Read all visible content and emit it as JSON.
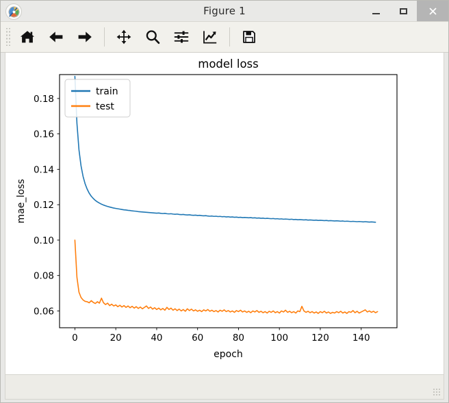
{
  "window": {
    "title": "Figure 1",
    "icon": "matplotlib-logo-icon",
    "minimize_label": "–",
    "maximize_label": "□",
    "close_label": "×"
  },
  "toolbar": {
    "buttons": [
      {
        "name": "home-button",
        "icon": "home-icon",
        "tooltip": "Reset original view"
      },
      {
        "name": "back-button",
        "icon": "arrow-left-icon",
        "tooltip": "Back to previous view"
      },
      {
        "name": "forward-button",
        "icon": "arrow-right-icon",
        "tooltip": "Forward to next view"
      },
      {
        "name": "pan-button",
        "icon": "move-arrows-icon",
        "tooltip": "Pan axes with left mouse, zoom with right"
      },
      {
        "name": "zoom-button",
        "icon": "magnifier-icon",
        "tooltip": "Zoom to rectangle"
      },
      {
        "name": "subplots-button",
        "icon": "sliders-icon",
        "tooltip": "Configure subplots"
      },
      {
        "name": "axis-editor-button",
        "icon": "line-chart-icon",
        "tooltip": "Edit axis, curve and image parameters"
      },
      {
        "name": "save-button",
        "icon": "floppy-disk-icon",
        "tooltip": "Save the figure"
      }
    ]
  },
  "status": {
    "coordinates": ""
  },
  "chart_data": {
    "type": "line",
    "title": "model loss",
    "xlabel": "epoch",
    "ylabel": "mae_loss",
    "grid": false,
    "legend_position": "upper left",
    "xlim": [
      -7.5,
      157.5
    ],
    "ylim": [
      0.0505,
      0.1935
    ],
    "xticks": [
      0,
      20,
      40,
      60,
      80,
      100,
      120,
      140
    ],
    "xtick_labels": [
      "0",
      "20",
      "40",
      "60",
      "80",
      "100",
      "120",
      "140"
    ],
    "yticks": [
      0.06,
      0.08,
      0.1,
      0.12,
      0.14,
      0.16,
      0.18
    ],
    "ytick_labels": [
      "0.06",
      "0.08",
      "0.10",
      "0.12",
      "0.14",
      "0.16",
      "0.18"
    ],
    "colors": {
      "train": "#1f77b4",
      "test": "#ff7f0e"
    },
    "series": [
      {
        "name": "train",
        "color": "#1f77b4",
        "x": [
          0,
          1,
          2,
          3,
          4,
          5,
          6,
          7,
          8,
          9,
          10,
          11,
          12,
          13,
          14,
          15,
          16,
          17,
          18,
          19,
          20,
          21,
          22,
          23,
          24,
          25,
          26,
          27,
          28,
          29,
          30,
          31,
          32,
          33,
          34,
          35,
          36,
          37,
          38,
          39,
          40,
          41,
          42,
          43,
          44,
          45,
          46,
          47,
          48,
          49,
          50,
          51,
          52,
          53,
          54,
          55,
          56,
          57,
          58,
          59,
          60,
          61,
          62,
          63,
          64,
          65,
          66,
          67,
          68,
          69,
          70,
          71,
          72,
          73,
          74,
          75,
          76,
          77,
          78,
          79,
          80,
          81,
          82,
          83,
          84,
          85,
          86,
          87,
          88,
          89,
          90,
          91,
          92,
          93,
          94,
          95,
          96,
          97,
          98,
          99,
          100,
          101,
          102,
          103,
          104,
          105,
          106,
          107,
          108,
          109,
          110,
          111,
          112,
          113,
          114,
          115,
          116,
          117,
          118,
          119,
          120,
          121,
          122,
          123,
          124,
          125,
          126,
          127,
          128,
          129,
          130,
          131,
          132,
          133,
          134,
          135,
          136,
          137,
          138,
          139,
          140,
          141,
          142,
          143,
          144,
          145,
          146,
          147,
          148,
          149
        ],
        "values": [
          0.1925,
          0.166,
          0.151,
          0.142,
          0.136,
          0.1318,
          0.1288,
          0.1265,
          0.1248,
          0.1235,
          0.1224,
          0.1216,
          0.1209,
          0.1203,
          0.1198,
          0.1194,
          0.119,
          0.1187,
          0.1184,
          0.1181,
          0.1179,
          0.1177,
          0.1175,
          0.1173,
          0.1171,
          0.117,
          0.1168,
          0.1167,
          0.1165,
          0.1164,
          0.1163,
          0.1161,
          0.116,
          0.1159,
          0.1158,
          0.1157,
          0.1156,
          0.1155,
          0.1154,
          0.1153,
          0.1152,
          0.1153,
          0.1151,
          0.115,
          0.1151,
          0.1149,
          0.1148,
          0.1149,
          0.1147,
          0.1146,
          0.1147,
          0.1145,
          0.1144,
          0.1145,
          0.1143,
          0.1142,
          0.1143,
          0.1141,
          0.114,
          0.1141,
          0.1139,
          0.114,
          0.1138,
          0.1137,
          0.1138,
          0.1136,
          0.1135,
          0.1136,
          0.1134,
          0.1135,
          0.1133,
          0.1134,
          0.1132,
          0.1133,
          0.1131,
          0.1132,
          0.113,
          0.1131,
          0.1129,
          0.113,
          0.1128,
          0.1129,
          0.1127,
          0.1128,
          0.1127,
          0.1126,
          0.1127,
          0.1125,
          0.1126,
          0.1124,
          0.1125,
          0.1123,
          0.1124,
          0.1122,
          0.1123,
          0.1122,
          0.1121,
          0.1122,
          0.112,
          0.1121,
          0.1119,
          0.112,
          0.1118,
          0.1119,
          0.1118,
          0.1117,
          0.1118,
          0.1116,
          0.1117,
          0.1115,
          0.1116,
          0.1115,
          0.1114,
          0.1115,
          0.1113,
          0.1114,
          0.1113,
          0.1112,
          0.1113,
          0.1111,
          0.1112,
          0.1111,
          0.111,
          0.1111,
          0.1109,
          0.111,
          0.1109,
          0.1108,
          0.1109,
          0.1108,
          0.1107,
          0.1108,
          0.1106,
          0.1107,
          0.1106,
          0.1105,
          0.1106,
          0.1105,
          0.1104,
          0.1105,
          0.1104,
          0.1103,
          0.1104,
          0.1103,
          0.1102,
          0.1103,
          0.1102,
          0.1101
        ]
      },
      {
        "name": "test",
        "color": "#ff7f0e",
        "x": [
          0,
          1,
          2,
          3,
          4,
          5,
          6,
          7,
          8,
          9,
          10,
          11,
          12,
          13,
          14,
          15,
          16,
          17,
          18,
          19,
          20,
          21,
          22,
          23,
          24,
          25,
          26,
          27,
          28,
          29,
          30,
          31,
          32,
          33,
          34,
          35,
          36,
          37,
          38,
          39,
          40,
          41,
          42,
          43,
          44,
          45,
          46,
          47,
          48,
          49,
          50,
          51,
          52,
          53,
          54,
          55,
          56,
          57,
          58,
          59,
          60,
          61,
          62,
          63,
          64,
          65,
          66,
          67,
          68,
          69,
          70,
          71,
          72,
          73,
          74,
          75,
          76,
          77,
          78,
          79,
          80,
          81,
          82,
          83,
          84,
          85,
          86,
          87,
          88,
          89,
          90,
          91,
          92,
          93,
          94,
          95,
          96,
          97,
          98,
          99,
          100,
          101,
          102,
          103,
          104,
          105,
          106,
          107,
          108,
          109,
          110,
          111,
          112,
          113,
          114,
          115,
          116,
          117,
          118,
          119,
          120,
          121,
          122,
          123,
          124,
          125,
          126,
          127,
          128,
          129,
          130,
          131,
          132,
          133,
          134,
          135,
          136,
          137,
          138,
          139,
          140,
          141,
          142,
          143,
          144,
          145,
          146,
          147,
          148,
          149
        ],
        "values": [
          0.1,
          0.079,
          0.0706,
          0.0676,
          0.0662,
          0.0654,
          0.0652,
          0.0646,
          0.0658,
          0.0648,
          0.0642,
          0.0652,
          0.0644,
          0.0672,
          0.0646,
          0.0636,
          0.0644,
          0.063,
          0.0638,
          0.0628,
          0.0634,
          0.0624,
          0.0632,
          0.0622,
          0.063,
          0.062,
          0.0628,
          0.0618,
          0.0626,
          0.0616,
          0.0624,
          0.0614,
          0.0622,
          0.0612,
          0.062,
          0.0628,
          0.0614,
          0.0622,
          0.061,
          0.0618,
          0.0608,
          0.0616,
          0.0606,
          0.0614,
          0.0604,
          0.062,
          0.0608,
          0.0616,
          0.0604,
          0.0612,
          0.0602,
          0.061,
          0.06,
          0.0608,
          0.0598,
          0.0612,
          0.0602,
          0.061,
          0.06,
          0.0606,
          0.0598,
          0.0604,
          0.0596,
          0.0606,
          0.06,
          0.0608,
          0.0598,
          0.0604,
          0.0596,
          0.0602,
          0.0594,
          0.0604,
          0.0598,
          0.0606,
          0.0596,
          0.0602,
          0.0594,
          0.06,
          0.0592,
          0.0602,
          0.0596,
          0.0604,
          0.0594,
          0.06,
          0.0592,
          0.0598,
          0.059,
          0.06,
          0.0594,
          0.0602,
          0.0592,
          0.0598,
          0.059,
          0.0596,
          0.0588,
          0.0598,
          0.0592,
          0.06,
          0.059,
          0.0596,
          0.0588,
          0.06,
          0.0594,
          0.0604,
          0.0592,
          0.0598,
          0.059,
          0.0596,
          0.0588,
          0.06,
          0.0596,
          0.0626,
          0.06,
          0.0592,
          0.0598,
          0.059,
          0.0596,
          0.0588,
          0.0594,
          0.0586,
          0.0596,
          0.059,
          0.0598,
          0.0588,
          0.0594,
          0.0586,
          0.0592,
          0.0588,
          0.0596,
          0.059,
          0.0598,
          0.0588,
          0.0594,
          0.0586,
          0.0596,
          0.0592,
          0.0602,
          0.059,
          0.0598,
          0.0588,
          0.0594,
          0.06,
          0.0606,
          0.0594,
          0.06,
          0.0592,
          0.0598,
          0.059,
          0.0596
        ]
      }
    ],
    "legend": [
      {
        "label": "train",
        "color": "#1f77b4"
      },
      {
        "label": "test",
        "color": "#ff7f0e"
      }
    ]
  }
}
